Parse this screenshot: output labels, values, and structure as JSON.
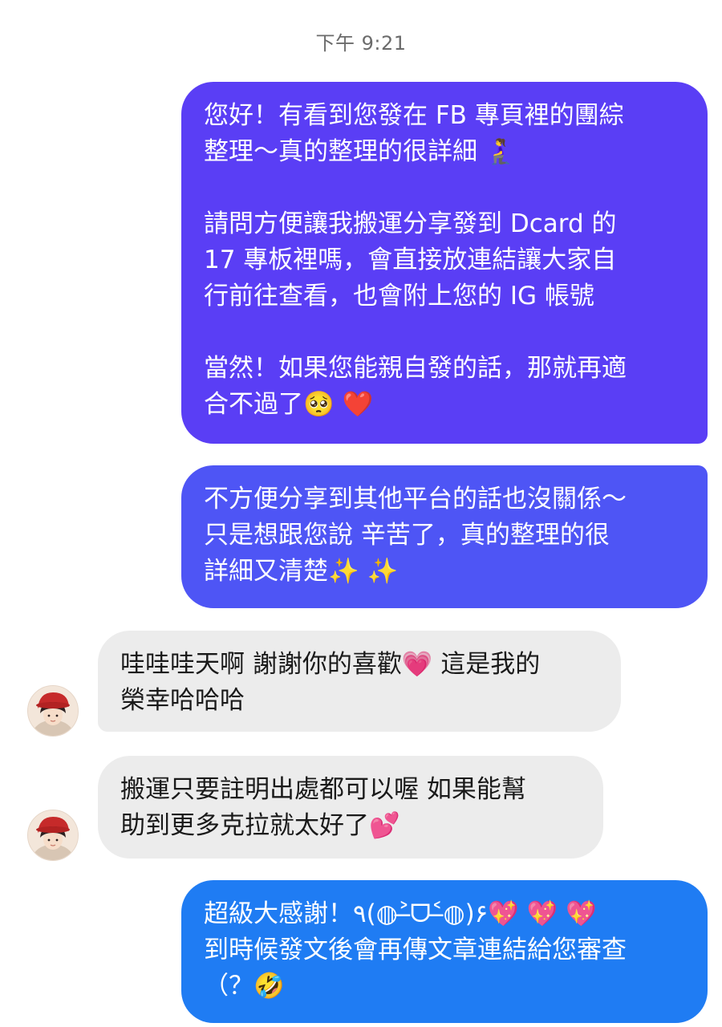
{
  "conversation": {
    "timestamp": "下午 9:21",
    "messages": [
      {
        "sender": "me",
        "paragraphs": [
          "您好！有看到您發在 FB 專頁裡的團綜\n整理～真的整理的很詳細 🧎‍♀️",
          "請問方便讓我搬運分享發到 Dcard 的\n17 專板裡嗎，會直接放連結讓大家自\n行前往查看，也會附上您的 IG 帳號",
          "當然！如果您能親自發的話，那就再適\n合不過了🥺 ❤️"
        ]
      },
      {
        "sender": "me",
        "text": "不方便分享到其他平台的話也沒關係～\n只是想跟您說 辛苦了，真的整理的很\n詳細又清楚✨ ✨"
      },
      {
        "sender": "them",
        "text": "哇哇哇天啊 謝謝你的喜歡💗 這是我的\n榮幸哈哈哈"
      },
      {
        "sender": "them",
        "text": "搬運只要註明出處都可以喔 如果能幫\n助到更多克拉就太好了💕"
      },
      {
        "sender": "me",
        "text": "超級大感謝！٩(◍˃̶ᗜ˂̶◍)۶💖 💖 💖\n到時候發文後會再傳文章連結給您審查\n（？🤣"
      }
    ]
  },
  "colors": {
    "bubble_1": "#5a3ef5",
    "bubble_2": "#4e55f5",
    "bubble_5": "#1f7cf3",
    "received_bubble": "#ececec",
    "timestamp_text": "#6b6b6b"
  },
  "icons": {
    "avatar": "user-avatar-red-hat"
  }
}
